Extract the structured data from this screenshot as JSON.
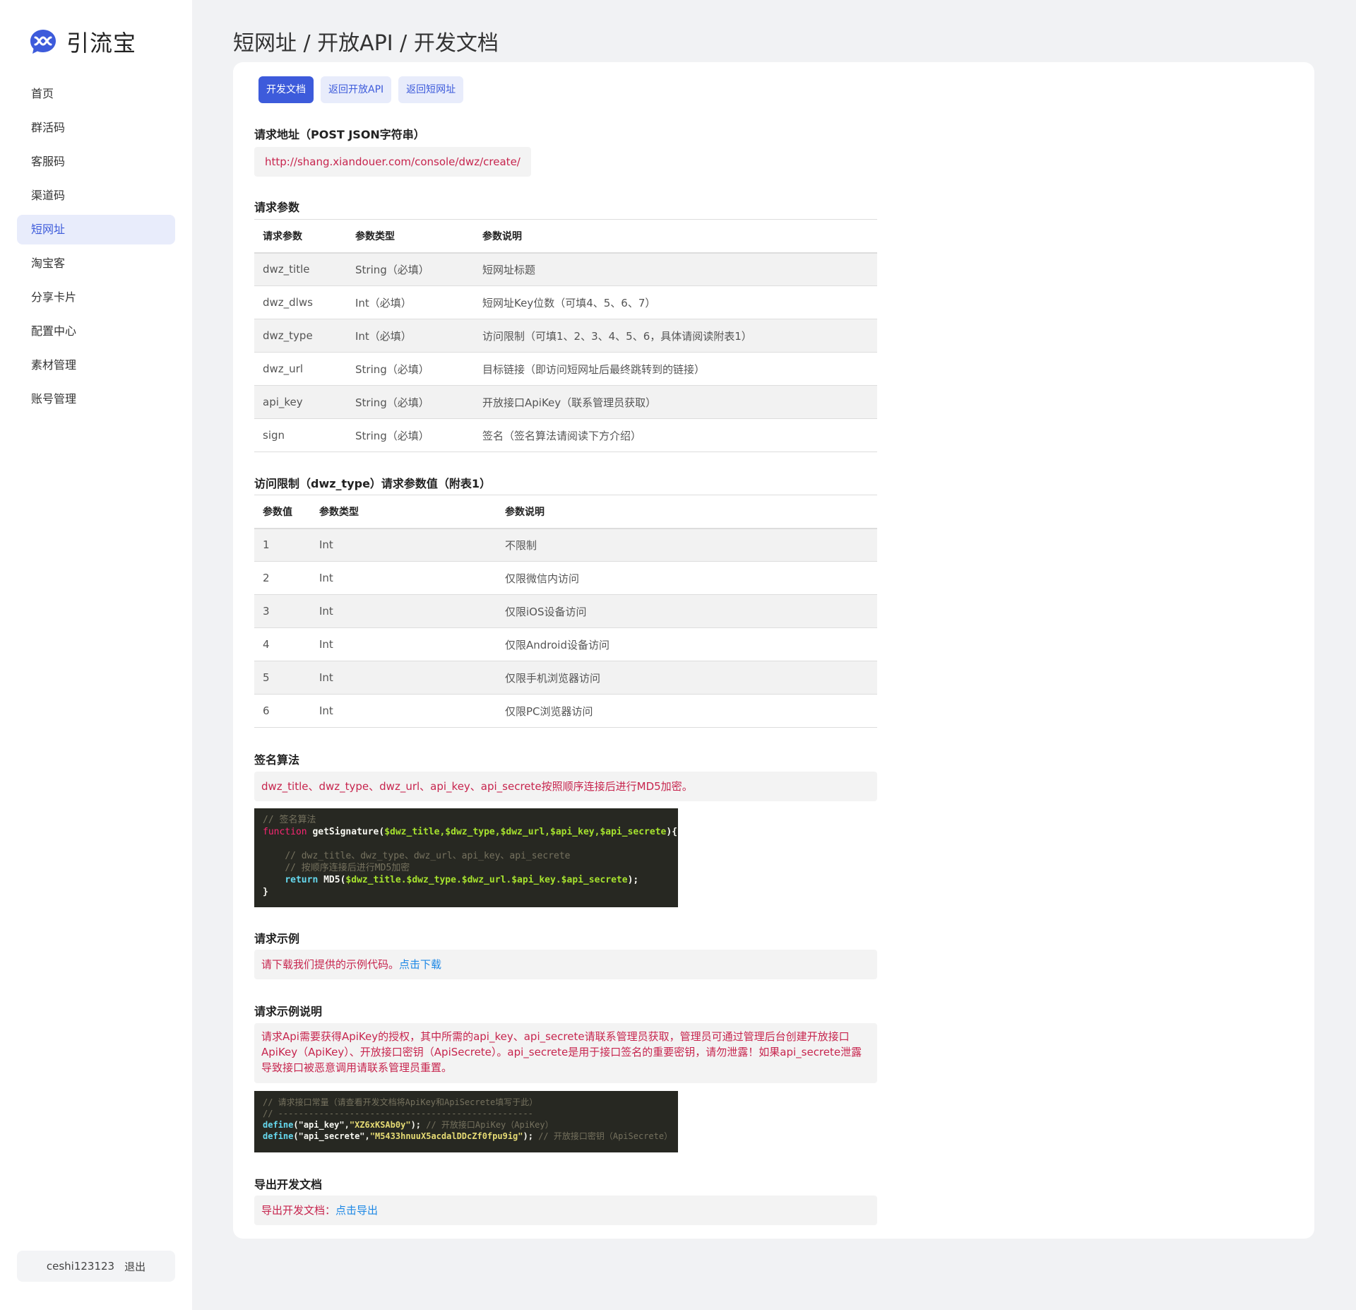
{
  "app": {
    "logo_text": "引流宝",
    "accent": "#3d5bdb"
  },
  "sidebar": {
    "items": [
      {
        "label": "首页"
      },
      {
        "label": "群活码"
      },
      {
        "label": "客服码"
      },
      {
        "label": "渠道码"
      },
      {
        "label": "短网址",
        "active": true
      },
      {
        "label": "淘宝客"
      },
      {
        "label": "分享卡片"
      },
      {
        "label": "配置中心"
      },
      {
        "label": "素材管理"
      },
      {
        "label": "账号管理"
      }
    ],
    "user": {
      "name": "ceshi123123",
      "logout": "退出"
    }
  },
  "breadcrumb": "短网址 / 开放API / 开发文档",
  "tabs": [
    {
      "label": "开发文档",
      "active": true
    },
    {
      "label": "返回开放API"
    },
    {
      "label": "返回短网址"
    }
  ],
  "request_url": {
    "title": "请求地址（POST JSON字符串）",
    "url": "http://shang.xiandouer.com/console/dwz/create/"
  },
  "params": {
    "title": "请求参数",
    "headers": [
      "请求参数",
      "参数类型",
      "参数说明"
    ],
    "rows": [
      [
        "dwz_title",
        "String（必填）",
        "短网址标题"
      ],
      [
        "dwz_dlws",
        "Int（必填）",
        "短网址Key位数（可填4、5、6、7）"
      ],
      [
        "dwz_type",
        "Int（必填）",
        "访问限制（可填1、2、3、4、5、6，具体请阅读附表1）"
      ],
      [
        "dwz_url",
        "String（必填）",
        "目标链接（即访问短网址后最终跳转到的链接）"
      ],
      [
        "api_key",
        "String（必填）",
        "开放接口ApiKey（联系管理员获取）"
      ],
      [
        "sign",
        "String（必填）",
        "签名（签名算法请阅读下方介绍）"
      ]
    ]
  },
  "appendix": {
    "title": "访问限制（dwz_type）请求参数值（附表1）",
    "headers": [
      "参数值",
      "参数类型",
      "参数说明"
    ],
    "rows": [
      [
        "1",
        "Int",
        "不限制"
      ],
      [
        "2",
        "Int",
        "仅限微信内访问"
      ],
      [
        "3",
        "Int",
        "仅限iOS设备访问"
      ],
      [
        "4",
        "Int",
        "仅限Android设备访问"
      ],
      [
        "5",
        "Int",
        "仅限手机浏览器访问"
      ],
      [
        "6",
        "Int",
        "仅限PC浏览器访问"
      ]
    ]
  },
  "sign_algo": {
    "title": "签名算法",
    "note": "dwz_title、dwz_type、dwz_url、api_key、api_secrete按照顺序连接后进行MD5加密。",
    "code": {
      "comment1": "// 签名算法",
      "kw_function": "function",
      "fn_name": "getSignature",
      "params": "$dwz_title,$dwz_type,$dwz_url,$api_key,$api_secrete",
      "comment2": "// dwz_title、dwz_type、dwz_url、api_key、api_secrete",
      "comment3": "// 按顺序连接后进行MD5加密",
      "kw_return": "return",
      "md5": "MD5",
      "concat": "$dwz_title.$dwz_type.$dwz_url.$api_key.$api_secrete"
    }
  },
  "example": {
    "title": "请求示例",
    "note": "请下载我们提供的示例代码。",
    "link": "点击下载"
  },
  "example_desc": {
    "title": "请求示例说明",
    "note": "请求Api需要获得ApiKey的授权，其中所需的api_key、api_secrete请联系管理员获取，管理员可通过管理后台创建开放接口ApiKey（ApiKey）、开放接口密钥（ApiSecrete）。api_secrete是用于接口签名的重要密钥，请勿泄露！如果api_secrete泄露导致接口被恶意调用请联系管理员重置。",
    "code": {
      "comment1": "// 请求接口常量（请查看开发文档将ApiKey和ApiSecrete填写于此）",
      "comment2": "// --------------------------------------------------",
      "define": "define",
      "key_name": "\"api_key\"",
      "key_value": "\"XZ6xKSAb0y\"",
      "key_comment": "// 开放接口ApiKey（ApiKey）",
      "secret_name": "\"api_secrete\"",
      "secret_value": "\"M5433hnuuX5acdalDDcZf0fpu9ig\"",
      "secret_comment": "// 开放接口密钥（ApiSecrete）"
    }
  },
  "export": {
    "title": "导出开发文档",
    "note": "导出开发文档：",
    "link": "点击导出"
  }
}
